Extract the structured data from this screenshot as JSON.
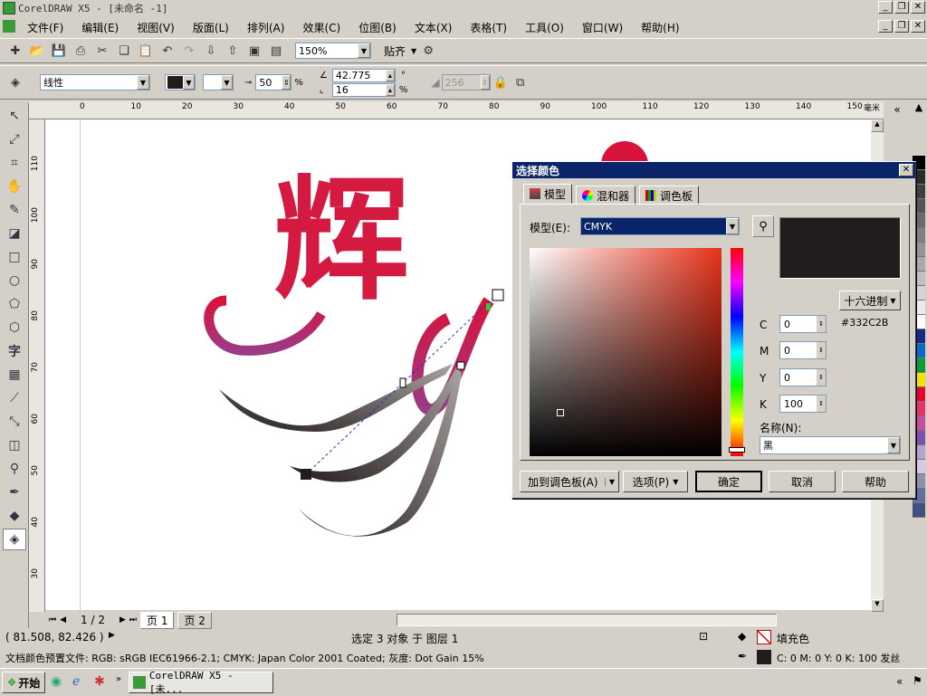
{
  "window": {
    "title": "CorelDRAW X5 - [未命名 -1]"
  },
  "menu": [
    "文件(F)",
    "编辑(E)",
    "视图(V)",
    "版面(L)",
    "排列(A)",
    "效果(C)",
    "位图(B)",
    "文本(X)",
    "表格(T)",
    "工具(O)",
    "窗口(W)",
    "帮助(H)"
  ],
  "toolbar": {
    "zoom": "150%",
    "snap_label": "贴齐"
  },
  "property_bar": {
    "fill_type": "线性",
    "midpoint": "50",
    "midpoint_unit": "%",
    "angle": "42.775",
    "angle_unit": "°",
    "edge_pad": "16",
    "edge_unit": "%",
    "steps": "256"
  },
  "ruler": {
    "h_ticks": [
      "0",
      "10",
      "20",
      "30",
      "40",
      "50",
      "60",
      "70",
      "80",
      "90",
      "100",
      "110",
      "120",
      "130",
      "140",
      "150"
    ],
    "h_unit": "毫米",
    "v_ticks": [
      "110",
      "100",
      "90",
      "80",
      "70",
      "60",
      "50",
      "40",
      "30"
    ]
  },
  "artwork": {
    "text": "辉"
  },
  "pages": {
    "counter": "1 / 2",
    "tabs": [
      "页 1",
      "页 2"
    ]
  },
  "status": {
    "coords": "( 81.508, 82.426 )",
    "selection": "选定 3 对象 于 图层 1",
    "fill_label": "填充色",
    "profile": "文档颜色预置文件: RGB: sRGB IEC61966-2.1; CMYK: Japan Color 2001 Coated; 灰度: Dot Gain 15%",
    "outline": "C: 0 M: 0 Y: 0 K: 100  发丝"
  },
  "dialog": {
    "title": "选择颜色",
    "tabs": [
      "模型",
      "混和器",
      "调色板"
    ],
    "model_label": "模型(E):",
    "model_value": "CMYK",
    "hex_mode": "十六进制",
    "hex_value": "#332C2B",
    "channels": [
      {
        "name": "C",
        "value": "0"
      },
      {
        "name": "M",
        "value": "0"
      },
      {
        "name": "Y",
        "value": "0"
      },
      {
        "name": "K",
        "value": "100"
      }
    ],
    "name_label": "名称(N):",
    "name_value": "黑",
    "buttons": {
      "add": "加到调色板(A)",
      "options": "选项(P)",
      "ok": "确定",
      "cancel": "取消",
      "help": "帮助"
    },
    "preview_color": "#231c1c"
  },
  "taskbar": {
    "start": "开始",
    "task": "CorelDRAW X5 - [未..."
  }
}
